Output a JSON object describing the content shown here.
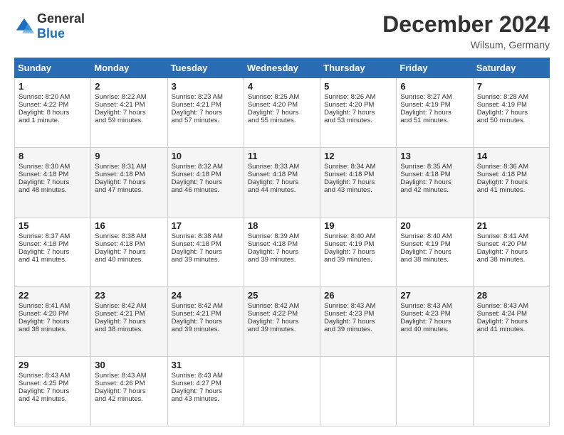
{
  "header": {
    "logo_general": "General",
    "logo_blue": "Blue",
    "title": "December 2024",
    "location": "Wilsum, Germany"
  },
  "days_of_week": [
    "Sunday",
    "Monday",
    "Tuesday",
    "Wednesday",
    "Thursday",
    "Friday",
    "Saturday"
  ],
  "weeks": [
    [
      {
        "day": "1",
        "lines": [
          "Sunrise: 8:20 AM",
          "Sunset: 4:22 PM",
          "Daylight: 8 hours",
          "and 1 minute."
        ]
      },
      {
        "day": "2",
        "lines": [
          "Sunrise: 8:22 AM",
          "Sunset: 4:21 PM",
          "Daylight: 7 hours",
          "and 59 minutes."
        ]
      },
      {
        "day": "3",
        "lines": [
          "Sunrise: 8:23 AM",
          "Sunset: 4:21 PM",
          "Daylight: 7 hours",
          "and 57 minutes."
        ]
      },
      {
        "day": "4",
        "lines": [
          "Sunrise: 8:25 AM",
          "Sunset: 4:20 PM",
          "Daylight: 7 hours",
          "and 55 minutes."
        ]
      },
      {
        "day": "5",
        "lines": [
          "Sunrise: 8:26 AM",
          "Sunset: 4:20 PM",
          "Daylight: 7 hours",
          "and 53 minutes."
        ]
      },
      {
        "day": "6",
        "lines": [
          "Sunrise: 8:27 AM",
          "Sunset: 4:19 PM",
          "Daylight: 7 hours",
          "and 51 minutes."
        ]
      },
      {
        "day": "7",
        "lines": [
          "Sunrise: 8:28 AM",
          "Sunset: 4:19 PM",
          "Daylight: 7 hours",
          "and 50 minutes."
        ]
      }
    ],
    [
      {
        "day": "8",
        "lines": [
          "Sunrise: 8:30 AM",
          "Sunset: 4:18 PM",
          "Daylight: 7 hours",
          "and 48 minutes."
        ]
      },
      {
        "day": "9",
        "lines": [
          "Sunrise: 8:31 AM",
          "Sunset: 4:18 PM",
          "Daylight: 7 hours",
          "and 47 minutes."
        ]
      },
      {
        "day": "10",
        "lines": [
          "Sunrise: 8:32 AM",
          "Sunset: 4:18 PM",
          "Daylight: 7 hours",
          "and 46 minutes."
        ]
      },
      {
        "day": "11",
        "lines": [
          "Sunrise: 8:33 AM",
          "Sunset: 4:18 PM",
          "Daylight: 7 hours",
          "and 44 minutes."
        ]
      },
      {
        "day": "12",
        "lines": [
          "Sunrise: 8:34 AM",
          "Sunset: 4:18 PM",
          "Daylight: 7 hours",
          "and 43 minutes."
        ]
      },
      {
        "day": "13",
        "lines": [
          "Sunrise: 8:35 AM",
          "Sunset: 4:18 PM",
          "Daylight: 7 hours",
          "and 42 minutes."
        ]
      },
      {
        "day": "14",
        "lines": [
          "Sunrise: 8:36 AM",
          "Sunset: 4:18 PM",
          "Daylight: 7 hours",
          "and 41 minutes."
        ]
      }
    ],
    [
      {
        "day": "15",
        "lines": [
          "Sunrise: 8:37 AM",
          "Sunset: 4:18 PM",
          "Daylight: 7 hours",
          "and 41 minutes."
        ]
      },
      {
        "day": "16",
        "lines": [
          "Sunrise: 8:38 AM",
          "Sunset: 4:18 PM",
          "Daylight: 7 hours",
          "and 40 minutes."
        ]
      },
      {
        "day": "17",
        "lines": [
          "Sunrise: 8:38 AM",
          "Sunset: 4:18 PM",
          "Daylight: 7 hours",
          "and 39 minutes."
        ]
      },
      {
        "day": "18",
        "lines": [
          "Sunrise: 8:39 AM",
          "Sunset: 4:18 PM",
          "Daylight: 7 hours",
          "and 39 minutes."
        ]
      },
      {
        "day": "19",
        "lines": [
          "Sunrise: 8:40 AM",
          "Sunset: 4:19 PM",
          "Daylight: 7 hours",
          "and 39 minutes."
        ]
      },
      {
        "day": "20",
        "lines": [
          "Sunrise: 8:40 AM",
          "Sunset: 4:19 PM",
          "Daylight: 7 hours",
          "and 38 minutes."
        ]
      },
      {
        "day": "21",
        "lines": [
          "Sunrise: 8:41 AM",
          "Sunset: 4:20 PM",
          "Daylight: 7 hours",
          "and 38 minutes."
        ]
      }
    ],
    [
      {
        "day": "22",
        "lines": [
          "Sunrise: 8:41 AM",
          "Sunset: 4:20 PM",
          "Daylight: 7 hours",
          "and 38 minutes."
        ]
      },
      {
        "day": "23",
        "lines": [
          "Sunrise: 8:42 AM",
          "Sunset: 4:21 PM",
          "Daylight: 7 hours",
          "and 38 minutes."
        ]
      },
      {
        "day": "24",
        "lines": [
          "Sunrise: 8:42 AM",
          "Sunset: 4:21 PM",
          "Daylight: 7 hours",
          "and 39 minutes."
        ]
      },
      {
        "day": "25",
        "lines": [
          "Sunrise: 8:42 AM",
          "Sunset: 4:22 PM",
          "Daylight: 7 hours",
          "and 39 minutes."
        ]
      },
      {
        "day": "26",
        "lines": [
          "Sunrise: 8:43 AM",
          "Sunset: 4:23 PM",
          "Daylight: 7 hours",
          "and 39 minutes."
        ]
      },
      {
        "day": "27",
        "lines": [
          "Sunrise: 8:43 AM",
          "Sunset: 4:23 PM",
          "Daylight: 7 hours",
          "and 40 minutes."
        ]
      },
      {
        "day": "28",
        "lines": [
          "Sunrise: 8:43 AM",
          "Sunset: 4:24 PM",
          "Daylight: 7 hours",
          "and 41 minutes."
        ]
      }
    ],
    [
      {
        "day": "29",
        "lines": [
          "Sunrise: 8:43 AM",
          "Sunset: 4:25 PM",
          "Daylight: 7 hours",
          "and 42 minutes."
        ]
      },
      {
        "day": "30",
        "lines": [
          "Sunrise: 8:43 AM",
          "Sunset: 4:26 PM",
          "Daylight: 7 hours",
          "and 42 minutes."
        ]
      },
      {
        "day": "31",
        "lines": [
          "Sunrise: 8:43 AM",
          "Sunset: 4:27 PM",
          "Daylight: 7 hours",
          "and 43 minutes."
        ]
      },
      null,
      null,
      null,
      null
    ]
  ]
}
